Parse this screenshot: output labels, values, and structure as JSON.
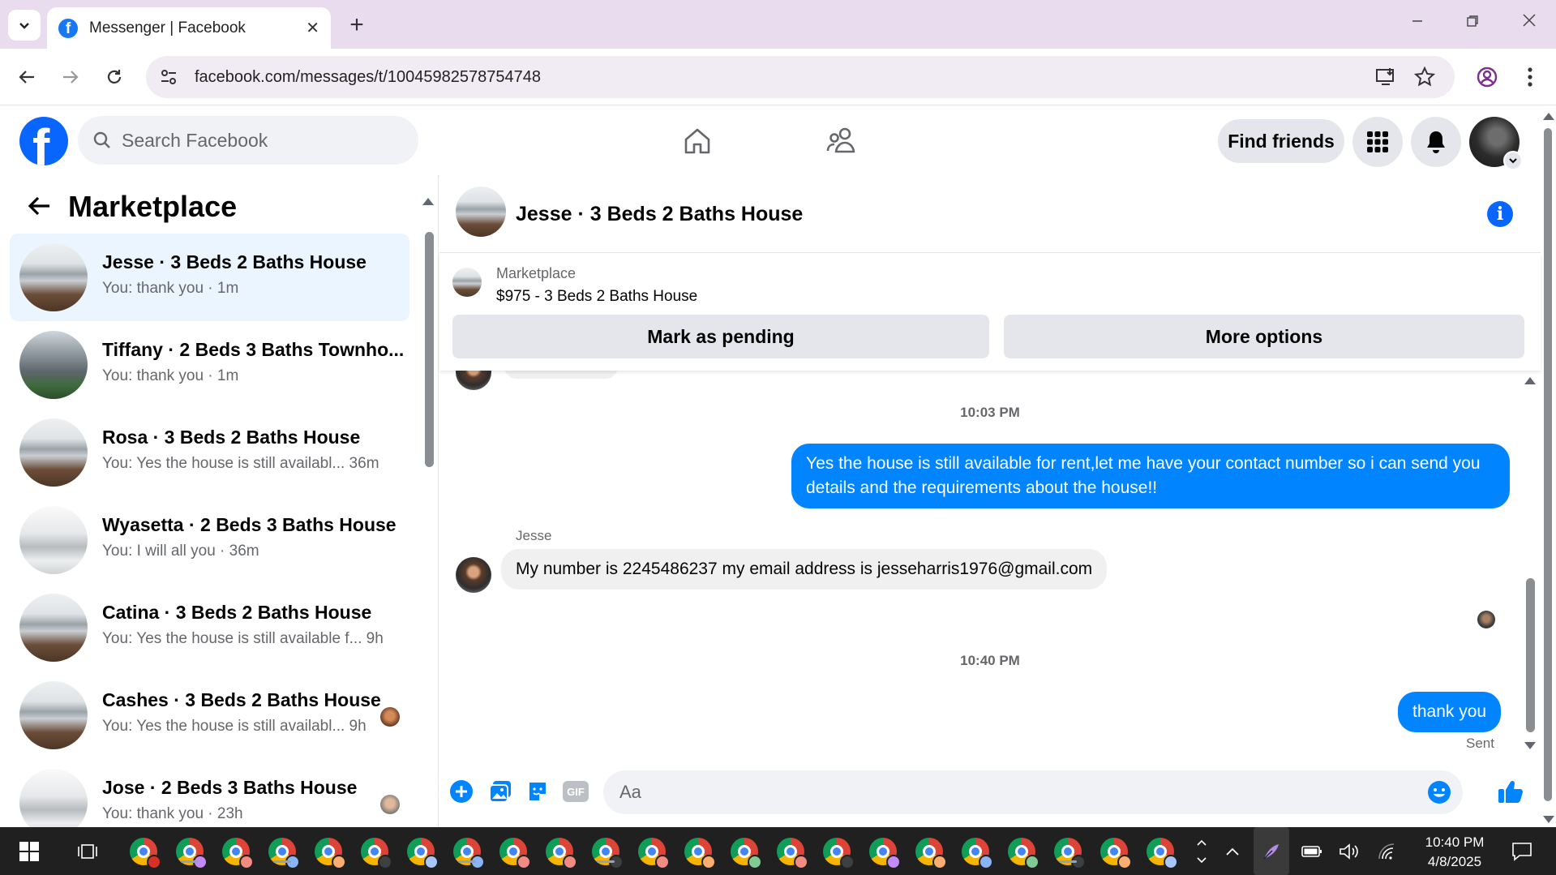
{
  "browser": {
    "tab_title": "Messenger | Facebook",
    "new_tab_label": "+",
    "url": "facebook.com/messages/t/10045982578754748"
  },
  "fb": {
    "search_placeholder": "Search Facebook",
    "find_friends": "Find friends",
    "logo_letter": "f"
  },
  "sidebar": {
    "title": "Marketplace",
    "conversations": [
      {
        "name": "Jesse · 3 Beds 2 Baths House",
        "preview": "You: thank you · 1m"
      },
      {
        "name": "Tiffany · 2 Beds 3 Baths Townho...",
        "preview": "You: thank you · 1m"
      },
      {
        "name": "Rosa · 3 Beds 2 Baths House",
        "preview": "You: Yes the house is still availabl...   36m"
      },
      {
        "name": "Wyasetta · 2 Beds 3 Baths House",
        "preview": "You: I will all you · 36m"
      },
      {
        "name": "Catina · 3 Beds 2 Baths House",
        "preview": "You: Yes the house is still available f...  9h"
      },
      {
        "name": "Cashes · 3 Beds 2 Baths House",
        "preview": "You: Yes the house is still availabl...  9h"
      },
      {
        "name": "Jose · 2 Beds 3 Baths House",
        "preview": "You: thank you · 23h"
      }
    ]
  },
  "chat": {
    "title": "Jesse · 3 Beds 2 Baths House",
    "listing_label": "Marketplace",
    "listing_price": "$975 - 3 Beds 2 Baths House",
    "mark_pending": "Mark as pending",
    "more_options": "More options",
    "timestamp_1": "10:03 PM",
    "outgoing_1": "Yes the house is still available for rent,let me have your contact number so i can send you details and the requirements about the house!!",
    "sender_name": "Jesse",
    "incoming_1": "My number is 2245486237 my email address is jesseharris1976@gmail.com",
    "timestamp_2": "10:40 PM",
    "outgoing_2": "thank you",
    "sent_status": "Sent",
    "composer_placeholder": "Aa",
    "gif_label": "GIF"
  },
  "taskbar": {
    "time": "10:40 PM",
    "date": "4/8/2025"
  },
  "colors": {
    "facebook_blue": "#0866ff",
    "messenger_bubble": "#0084ff",
    "active_conversation": "#ebf5ff",
    "tab_strip": "#e9dcee"
  }
}
